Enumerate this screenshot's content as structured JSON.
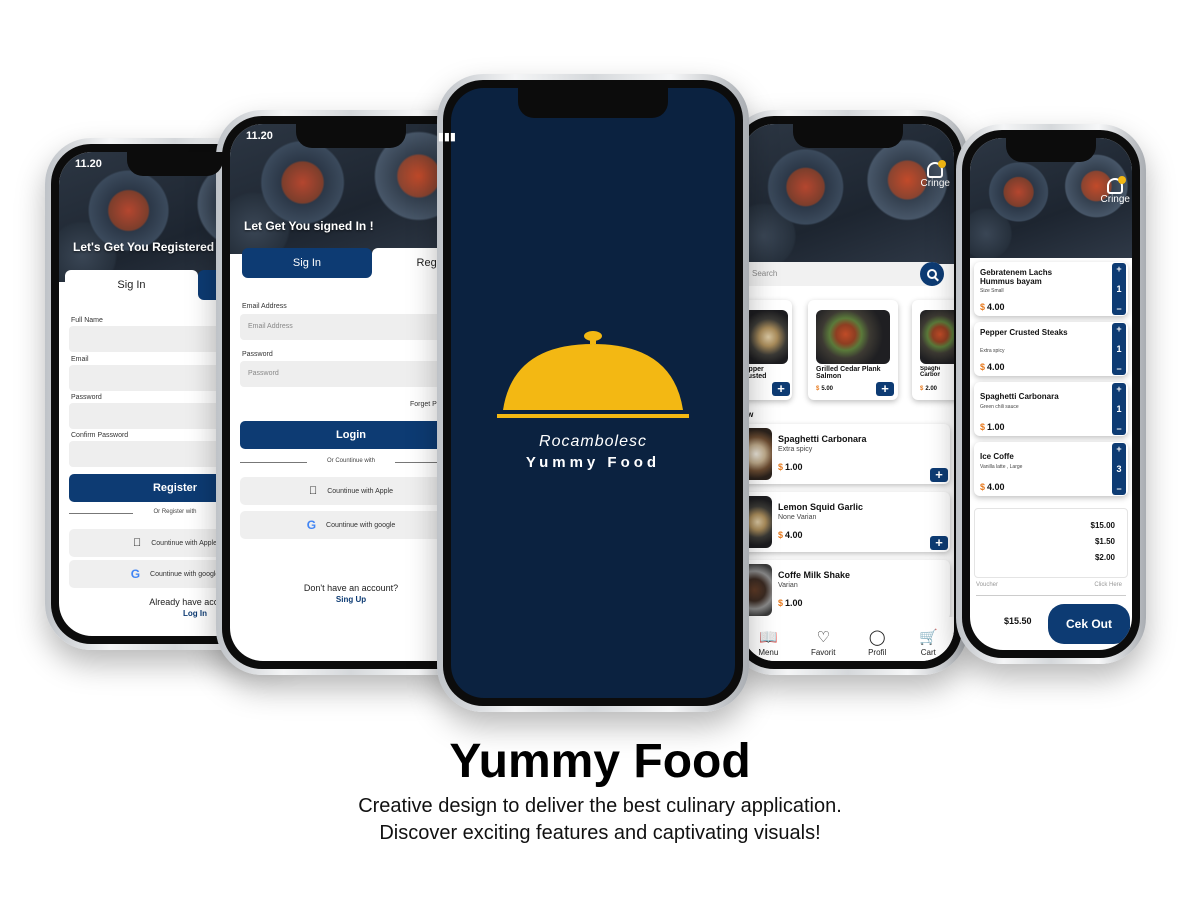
{
  "register_screen": {
    "time": "11.20",
    "title": "Let's Get You Registered",
    "tabs": [
      "Sig In",
      "Register"
    ],
    "fields": [
      "Full Name",
      "Email",
      "Password",
      "Confirm Password"
    ],
    "register_button": "Register",
    "divider": "Or Register with",
    "apple_button": "Countinue with Apple",
    "google_button": "Countinue with google",
    "footer_question": "Already have account?",
    "footer_link": "Log In"
  },
  "login_screen": {
    "time": "11.20",
    "title": "Let Get You signed In !",
    "tabs": [
      "Sig In",
      "Register"
    ],
    "email_label": "Email Address",
    "email_placeholder": "Email Address",
    "password_label": "Password",
    "password_placeholder": "Password",
    "forgot": "Forget Password?",
    "login_button": "Login",
    "divider": "Or Countinue with",
    "apple_button": "Countinue with Apple",
    "google_button": "Countinue with google",
    "footer_question": "Don't have an account?",
    "footer_link": "Sing Up"
  },
  "splash_screen": {
    "brand_sub": "Rocambolesc",
    "brand_main": "Yummy Food",
    "colors": {
      "background": "#0b2240",
      "cloche": "#f3b813"
    }
  },
  "menu_screen": {
    "notification_label": "Cringe",
    "search_placeholder": "Search",
    "featured": [
      {
        "name": "Pepper Crusted",
        "price": ""
      },
      {
        "name": "Grilled Cedar Plank Salmon",
        "price": "5.00"
      },
      {
        "name": "Spaghetti Carbonara",
        "price": "2.00"
      }
    ],
    "section_title": "Show",
    "list": [
      {
        "name": "Spaghetti Carbonara",
        "sub": "Extra  spicy",
        "price": "1.00"
      },
      {
        "name": "Lemon Squid Garlic",
        "sub": "None Varian",
        "price": "4.00"
      },
      {
        "name": "Coffe Milk Shake",
        "sub": "Varian",
        "price": "1.00"
      }
    ],
    "currency": "$",
    "nav": [
      "Menu",
      "Favorit",
      "Profil",
      "Cart"
    ]
  },
  "cart_screen": {
    "notification_label": "Cringe",
    "items": [
      {
        "name": "Gebratenem Lachs Hummus bayam",
        "sub": "Size Small",
        "price": "4.00",
        "qty": "1"
      },
      {
        "name": "Pepper Crusted Steaks",
        "sub": "Extra  spicy",
        "price": "4.00",
        "qty": "1"
      },
      {
        "name": "Spaghetti Carbonara",
        "sub": "Green chili sauce",
        "price": "1.00",
        "qty": "1"
      },
      {
        "name": "Ice Coffe",
        "sub": "Vanilla latte , Large",
        "price": "4.00",
        "qty": "3"
      }
    ],
    "currency": "$",
    "summary": [
      "$15.00",
      "$1.50",
      "$2.00"
    ],
    "voucher_label": "Voucher",
    "voucher_action": "Click Here",
    "total": "$15.50",
    "checkout": "Cek Out"
  },
  "caption": {
    "title": "Yummy Food",
    "line1": "Creative design to deliver the best culinary application.",
    "line2": "Discover exciting features and captivating visuals!"
  }
}
